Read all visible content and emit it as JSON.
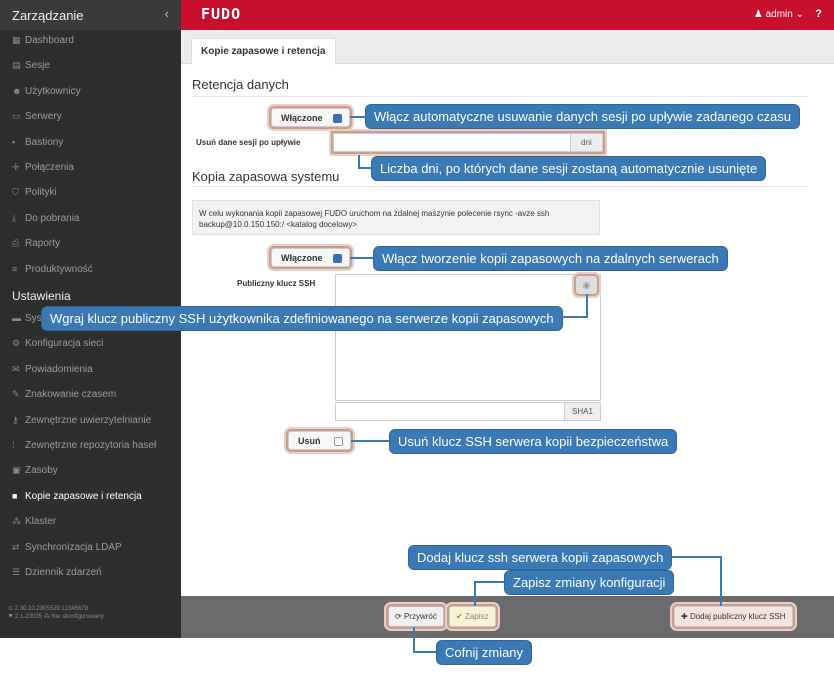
{
  "sidebar": {
    "title": "Zarządzanie",
    "collapse_icon": "‹",
    "management_items": [
      {
        "label": "Dashboard",
        "icon": "dashboard-icon",
        "glyph": "▦"
      },
      {
        "label": "Sesje",
        "icon": "film-icon",
        "glyph": "▤"
      },
      {
        "label": "Użytkownicy",
        "icon": "users-icon",
        "glyph": "☻"
      },
      {
        "label": "Serwery",
        "icon": "server-icon",
        "glyph": "▭"
      },
      {
        "label": "Bastiony",
        "icon": "bastion-icon",
        "glyph": "▪"
      },
      {
        "label": "Połączenia",
        "icon": "connections-icon",
        "glyph": "✛"
      },
      {
        "label": "Polityki",
        "icon": "policy-icon",
        "glyph": "⛉"
      },
      {
        "label": "Do pobrania",
        "icon": "download-icon",
        "glyph": "⤓"
      },
      {
        "label": "Raporty",
        "icon": "print-icon",
        "glyph": "⎙"
      },
      {
        "label": "Produktywność",
        "icon": "productivity-icon",
        "glyph": "≡"
      }
    ],
    "settings_title": "Ustawienia",
    "settings_items": [
      {
        "label": "Sys",
        "icon": "folder-icon",
        "glyph": "▬"
      },
      {
        "label": "Konfiguracja sieci",
        "icon": "network-icon",
        "glyph": "⚙"
      },
      {
        "label": "Powiadomienia",
        "icon": "mail-icon",
        "glyph": "✉"
      },
      {
        "label": "Znakowanie czasem",
        "icon": "edit-icon",
        "glyph": "✎"
      },
      {
        "label": "Zewnętrzne uwierzytelnianie",
        "icon": "key-icon",
        "glyph": "⚷"
      },
      {
        "label": "Zewnętrzne repozytoria haseł",
        "icon": "grid-icon",
        "glyph": "⁞"
      },
      {
        "label": "Zasoby",
        "icon": "image-icon",
        "glyph": "▣"
      },
      {
        "label": "Kopie zapasowe i retencja",
        "icon": "archive-icon",
        "glyph": "■",
        "active": true
      },
      {
        "label": "Klaster",
        "icon": "cluster-icon",
        "glyph": "⁂"
      },
      {
        "label": "Synchronizacja LDAP",
        "icon": "sync-icon",
        "glyph": "⇄"
      },
      {
        "label": "Dziennik zdarzeń",
        "icon": "log-icon",
        "glyph": "☰"
      }
    ],
    "version_line1": "⊙ 2.30.10.2305529.12345678",
    "version_line2": "⚑ 2.1-23035     ⁂ Nie skonfigurowany"
  },
  "topbar": {
    "logo": "FUDO",
    "user": "admin",
    "user_icon": "user-icon",
    "help": "?"
  },
  "tab": {
    "label": "Kopie zapasowe i retencja"
  },
  "retention": {
    "title": "Retencja danych",
    "enabled_label": "Włączone",
    "enabled": true,
    "delete_label": "Usuń dane sesji po upływie",
    "delete_value": "",
    "delete_unit": "dni"
  },
  "backup": {
    "title": "Kopia zapasowa systemu",
    "info_line1": "W celu wykonania kopii zapasowej FUDO uruchom na zdalnej maszynie polecenie rsync -avze ssh",
    "info_line2": "backup@10.0.150.150:/ <katalog docelowy>",
    "enabled_label": "Włączone",
    "enabled": true,
    "ssh_key_label": "Publiczny klucz SSH",
    "ssh_key_value": "",
    "sha_value": "",
    "sha_label": "SHA1",
    "delete_label": "Usuń",
    "delete_checked": false
  },
  "footer": {
    "revert_label": "Przywróć",
    "save_label": "Zapisz",
    "add_key_label": "Dodaj publiczny klucz SSH"
  },
  "callouts": {
    "retention_enable": "Włącz automatyczne usuwanie danych sesji po upływie zadanego czasu",
    "retention_days": "Liczba dni, po których dane sesji zostaną automatycznie usunięte",
    "backup_enable": "Włącz tworzenie kopii zapasowych na zdalnych serwerach",
    "upload_key": "Wgraj klucz publiczny SSH użytkownika zdefiniowanego na serwerze kopii zapasowych",
    "delete_key": "Usuń klucz SSH serwera kopii bezpieczeństwa",
    "add_key": "Dodaj klucz ssh serwera kopii zapasowych",
    "save": "Zapisz zmiany konfiguracji",
    "revert": "Cofnij zmiany"
  }
}
